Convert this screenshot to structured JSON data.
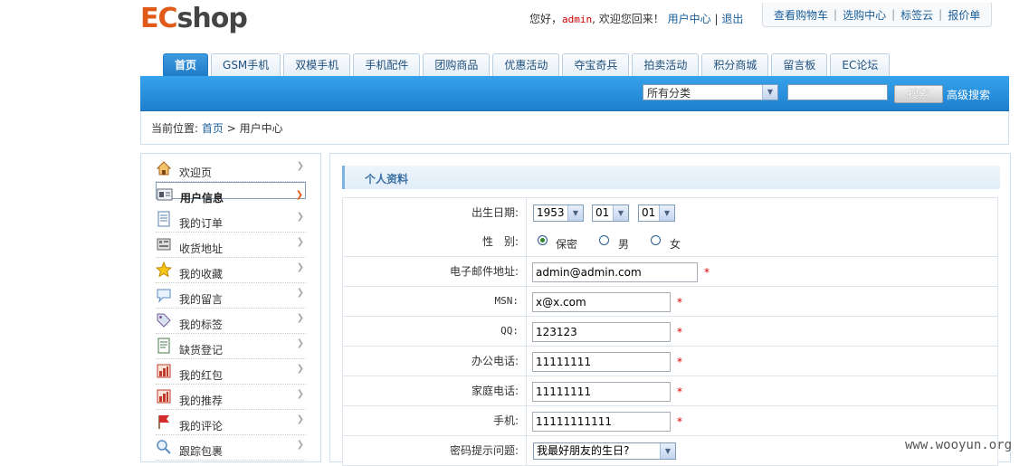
{
  "logo": {
    "part1": "EC",
    "part2": "shop"
  },
  "welcome": {
    "prefix": "您好，",
    "username": "admin",
    "suffix": ", 欢迎您回来！",
    "user_center": "用户中心",
    "sep": "|",
    "logout": "退出"
  },
  "toplinks": [
    "查看购物车",
    "选购中心",
    "标签云",
    "报价单"
  ],
  "nav_tabs": [
    "首页",
    "GSM手机",
    "双模手机",
    "手机配件",
    "团购商品",
    "优惠活动",
    "夺宝奇兵",
    "拍卖活动",
    "积分商城",
    "留言板",
    "EC论坛"
  ],
  "search": {
    "category": "所有分类",
    "button": "搜索",
    "advanced": "高级搜索"
  },
  "breadcrumb": {
    "prefix": "当前位置:",
    "home": "首页",
    "arrow": ">",
    "current": "用户中心"
  },
  "sidebar": {
    "items": [
      {
        "label": "欢迎页",
        "icon": "home-icon"
      },
      {
        "label": "用户信息",
        "icon": "id-card-icon",
        "selected": true
      },
      {
        "label": "我的订单",
        "icon": "document-icon"
      },
      {
        "label": "收货地址",
        "icon": "address-book-icon"
      },
      {
        "label": "我的收藏",
        "icon": "star-icon"
      },
      {
        "label": "我的留言",
        "icon": "speech-bubble-icon"
      },
      {
        "label": "我的标签",
        "icon": "tag-icon"
      },
      {
        "label": "缺货登记",
        "icon": "list-icon"
      },
      {
        "label": "我的红包",
        "icon": "chart-icon"
      },
      {
        "label": "我的推荐",
        "icon": "chart-icon"
      },
      {
        "label": "我的评论",
        "icon": "flag-icon"
      },
      {
        "label": "跟踪包裹",
        "icon": "search-icon"
      }
    ]
  },
  "profile": {
    "title": "个人资料",
    "birthday": {
      "label": "出生日期:",
      "year": "1953",
      "month": "01",
      "day": "01"
    },
    "gender": {
      "label": "性　别:",
      "options": [
        "保密",
        "男",
        "女"
      ],
      "selected": "保密"
    },
    "email": {
      "label": "电子邮件地址:",
      "value": "admin@admin.com"
    },
    "msn": {
      "label": "MSN:",
      "value": "x@x.com"
    },
    "qq": {
      "label": "QQ:",
      "value": "123123"
    },
    "office_phone": {
      "label": "办公电话:",
      "value": "11111111"
    },
    "home_phone": {
      "label": "家庭电话:",
      "value": "11111111"
    },
    "mobile": {
      "label": "手机:",
      "value": "11111111111"
    },
    "question": {
      "label": "密码提示问题:",
      "value": "我最好朋友的生日?"
    },
    "required_mark": "*"
  },
  "watermark": "www.wooyun.org"
}
